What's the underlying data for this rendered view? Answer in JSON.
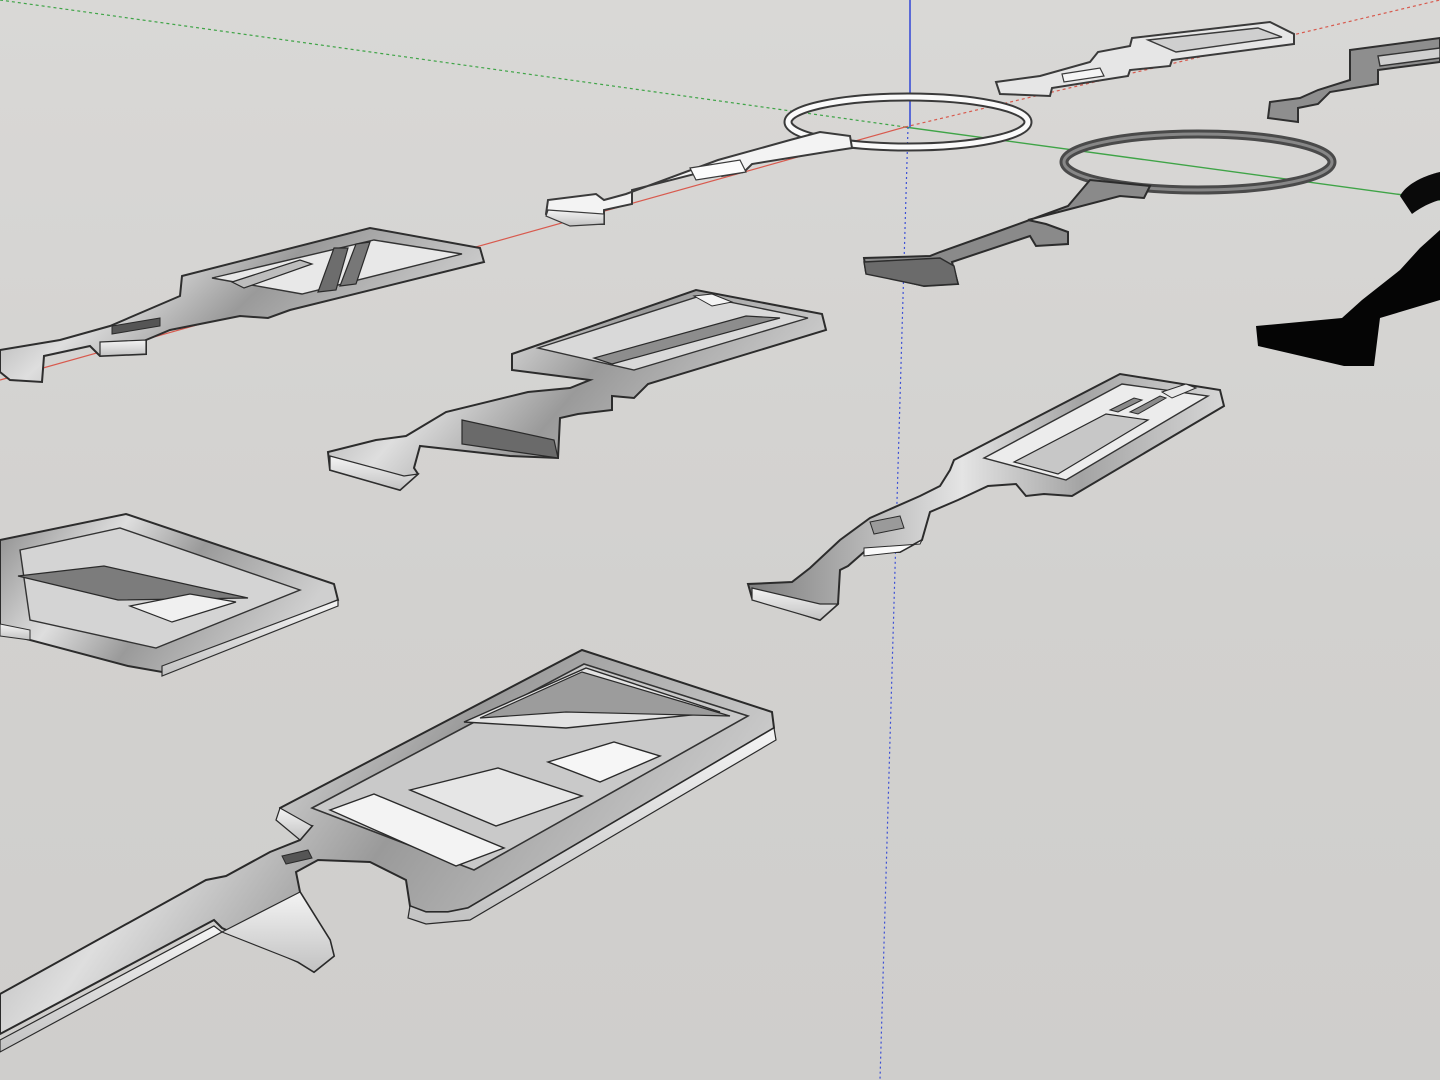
{
  "viewport": {
    "background": "#d3d2d0",
    "axes": {
      "red": "#d85a4e",
      "green": "#3fa447",
      "blue": "#3b4fd6"
    }
  },
  "models": [
    {
      "id": "key-ring-white",
      "style": "white",
      "head": "ring"
    },
    {
      "id": "key-ring-dark",
      "style": "dark",
      "head": "ring"
    },
    {
      "id": "key-frame-far",
      "style": "light",
      "head": "frame"
    },
    {
      "id": "key-frame-far-right",
      "style": "dark",
      "head": "frame"
    },
    {
      "id": "key-slant-blades",
      "style": "gray",
      "head": "frame"
    },
    {
      "id": "key-diagonal-mid",
      "style": "gray",
      "head": "frame"
    },
    {
      "id": "key-bars-right",
      "style": "gray",
      "head": "frame"
    },
    {
      "id": "key-diagonal-left",
      "style": "gray",
      "head": "frame"
    },
    {
      "id": "key-large-front",
      "style": "gray",
      "head": "frame"
    },
    {
      "id": "key-black-partial",
      "style": "black",
      "head": "ring"
    }
  ]
}
